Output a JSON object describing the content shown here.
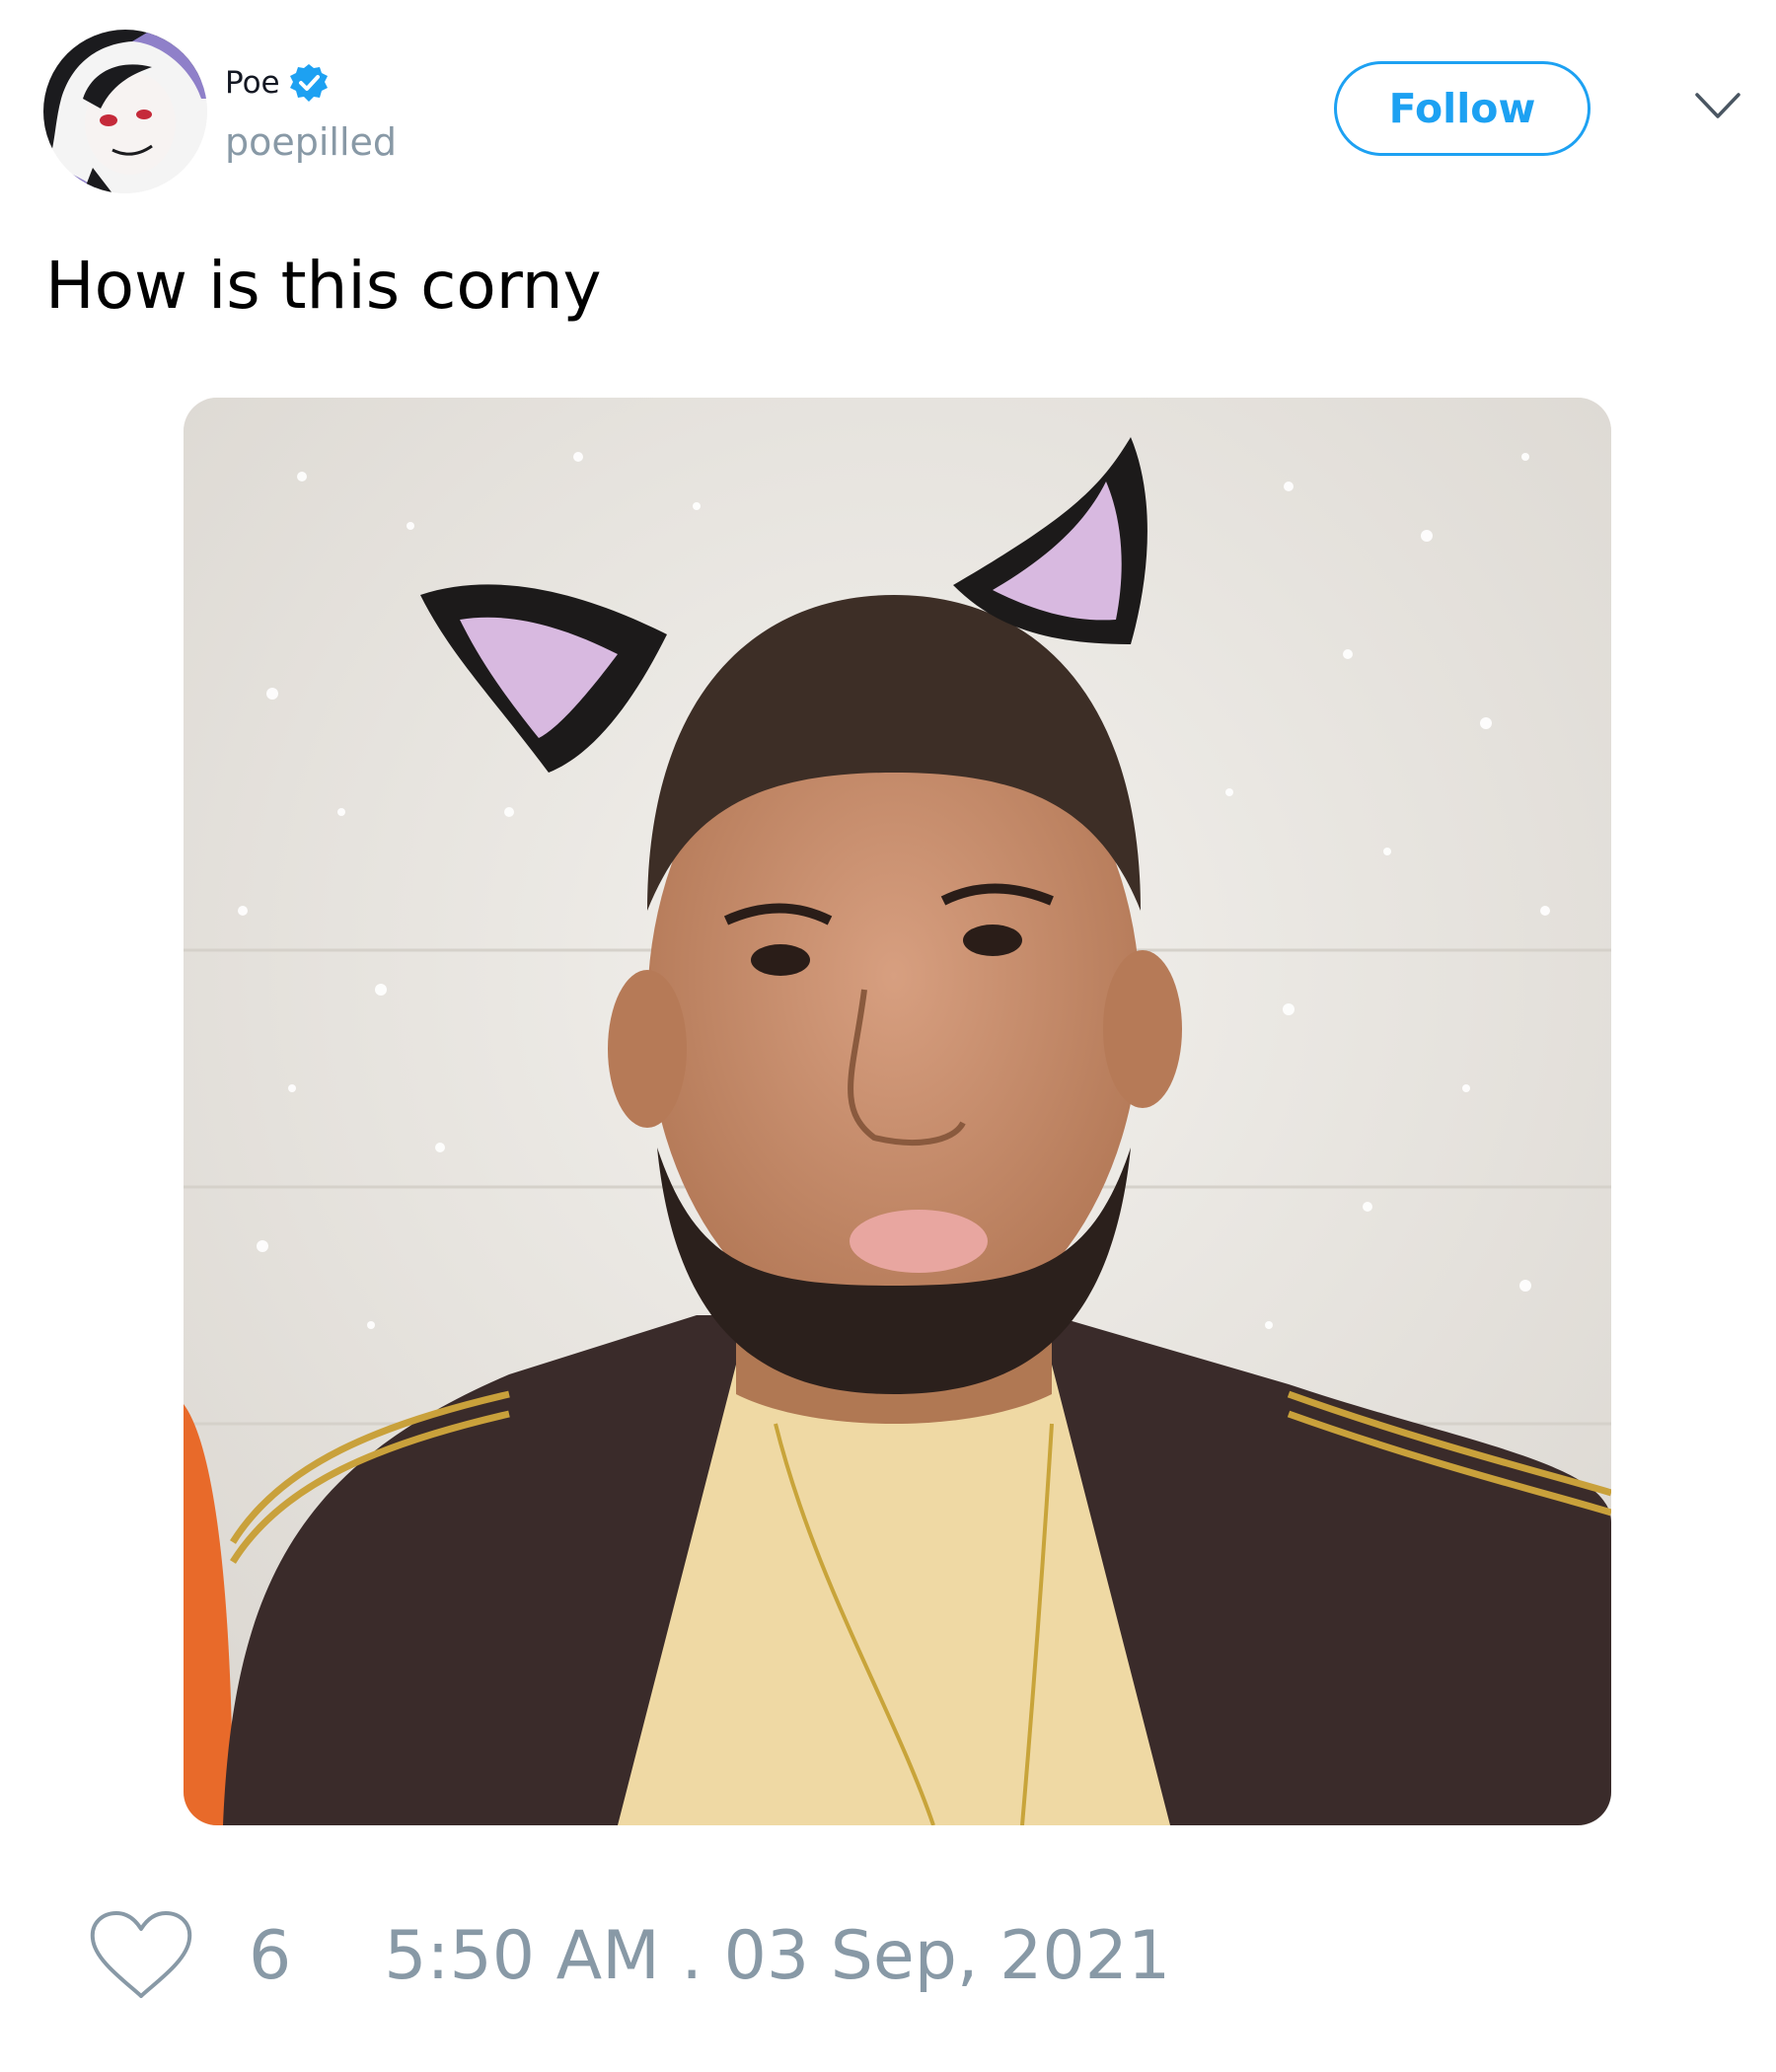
{
  "user": {
    "display_name": "Poe",
    "handle": "poepilled",
    "verified": true,
    "avatar_icon": "avatar-image"
  },
  "actions": {
    "follow_label": "Follow",
    "menu_icon": "chevron-down-icon"
  },
  "tweet": {
    "text": "How is this corny",
    "media_icon": "photo-image"
  },
  "footer": {
    "like_icon": "heart-outline-icon",
    "like_count": "6",
    "timestamp": "5:50 AM . 03 Sep, 2021"
  },
  "colors": {
    "accent": "#1da1f2",
    "muted_text": "#8899a6",
    "primary_text": "#000000"
  }
}
